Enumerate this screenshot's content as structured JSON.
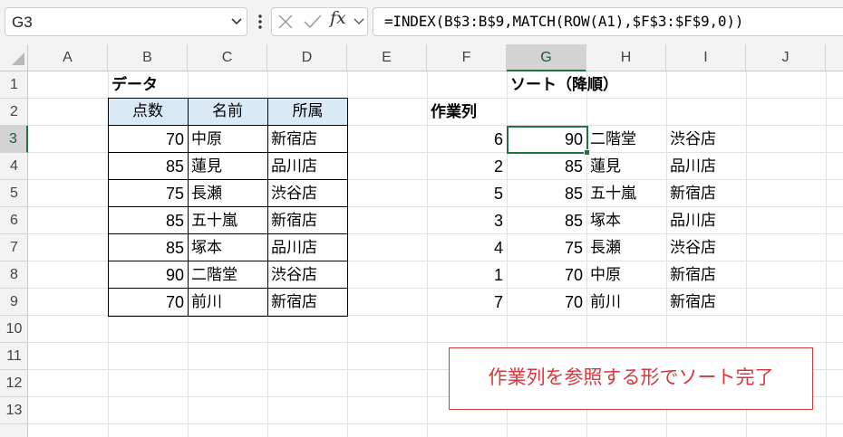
{
  "formula_bar": {
    "name_box": "G3",
    "fx_label": "fx",
    "formula": "=INDEX(B$3:B$9,MATCH(ROW(A1),$F$3:$F$9,0))"
  },
  "grid": {
    "columns": [
      "A",
      "B",
      "C",
      "D",
      "E",
      "F",
      "G",
      "H",
      "I",
      "J"
    ],
    "rows": [
      "1",
      "2",
      "3",
      "4",
      "5",
      "6",
      "7",
      "8",
      "9",
      "10",
      "11",
      "12",
      "13"
    ],
    "selected_column": "G",
    "selected_row": "3"
  },
  "left_table": {
    "title": "データ",
    "headers": [
      "点数",
      "名前",
      "所属"
    ],
    "rows": [
      [
        "70",
        "中原",
        "新宿店"
      ],
      [
        "85",
        "蓮見",
        "品川店"
      ],
      [
        "75",
        "長瀬",
        "渋谷店"
      ],
      [
        "85",
        "五十嵐",
        "新宿店"
      ],
      [
        "85",
        "塚本",
        "品川店"
      ],
      [
        "90",
        "二階堂",
        "渋谷店"
      ],
      [
        "70",
        "前川",
        "新宿店"
      ]
    ]
  },
  "right_table": {
    "title": "ソート（降順）",
    "work_header": "作業列",
    "rows": [
      [
        "6",
        "90",
        "二階堂",
        "渋谷店"
      ],
      [
        "2",
        "85",
        "蓮見",
        "品川店"
      ],
      [
        "5",
        "85",
        "五十嵐",
        "新宿店"
      ],
      [
        "3",
        "85",
        "塚本",
        "品川店"
      ],
      [
        "4",
        "75",
        "長瀬",
        "渋谷店"
      ],
      [
        "1",
        "70",
        "中原",
        "新宿店"
      ],
      [
        "7",
        "70",
        "前川",
        "新宿店"
      ]
    ]
  },
  "note": "作業列を参照する形でソート完了",
  "colors": {
    "header_fill": "#dae9f6",
    "selection": "#217346",
    "note": "#d9363e"
  }
}
